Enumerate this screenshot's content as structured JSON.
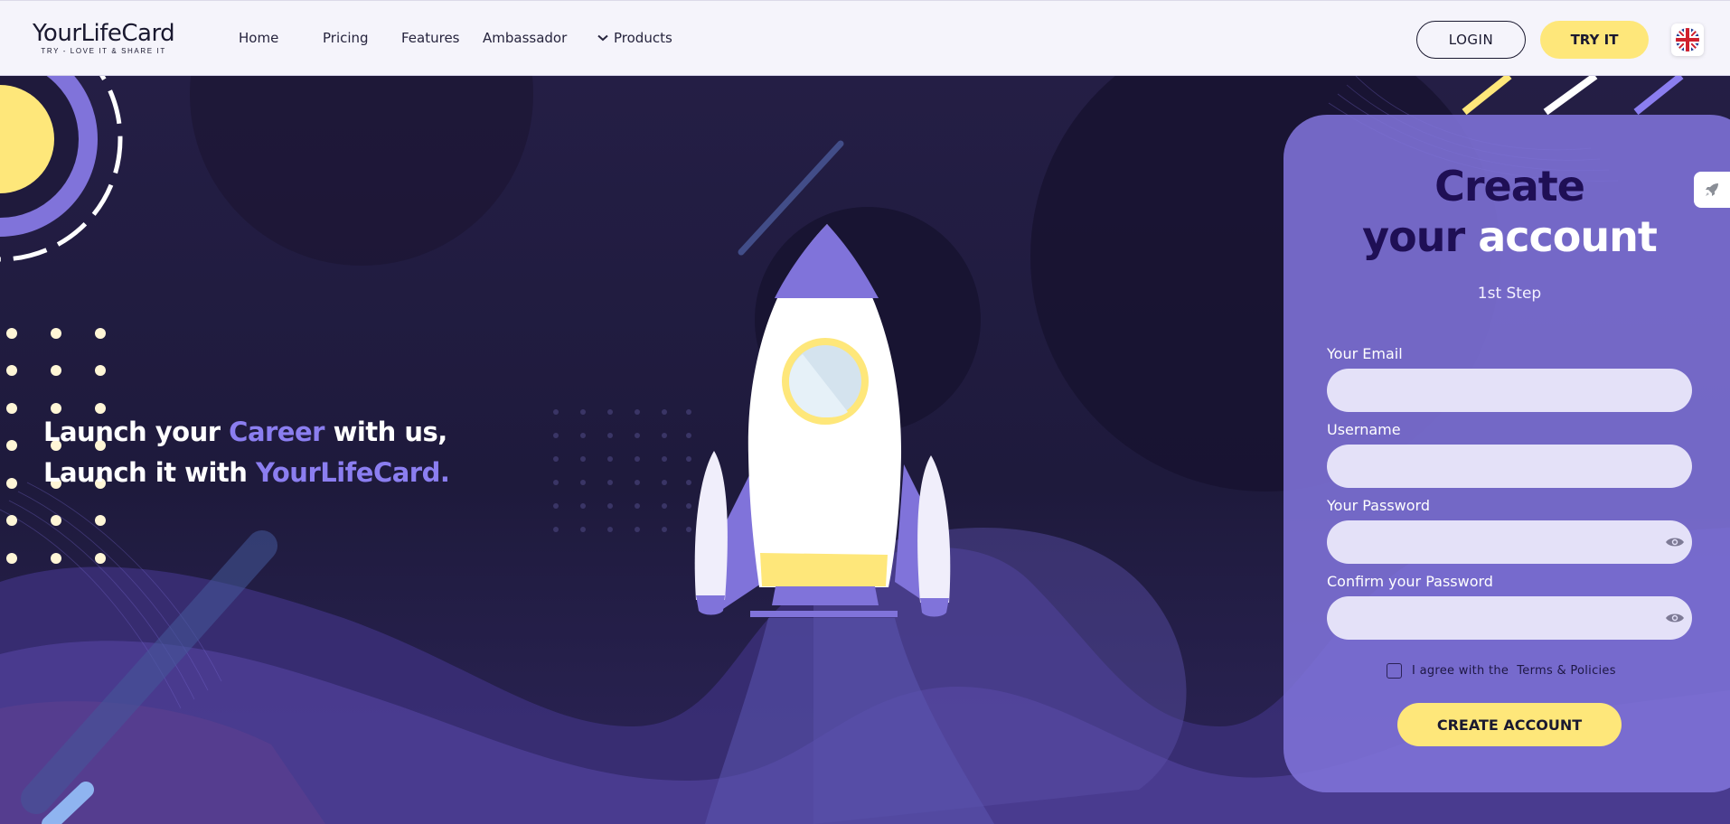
{
  "header": {
    "logo_title": "YourLifeCard",
    "logo_tagline": "TRY - LOVE IT & SHARE IT",
    "nav": {
      "home": "Home",
      "pricing": "Pricing",
      "features": "Features",
      "ambassador": "Ambassador",
      "products": "Products"
    },
    "login_label": "LOGIN",
    "try_label": "TRY IT",
    "language_icon": "uk-flag-icon"
  },
  "hero": {
    "line1_prefix": "Launch your",
    "line1_accent": "Career",
    "line1_suffix": "with us,",
    "line2_prefix": "Launch it with",
    "line2_accent": "YourLifeCard."
  },
  "form": {
    "title_line1": "Create",
    "title_line2_dark": "your",
    "title_line2_light": "account",
    "step": "1st Step",
    "email_label": "Your Email",
    "email_value": "",
    "username_label": "Username",
    "username_value": "",
    "password_label": "Your Password",
    "password_value": "",
    "confirm_label": "Confirm your Password",
    "confirm_value": "",
    "agree_text": "I agree with the",
    "terms_link": "Terms & Policies",
    "terms_checked": false,
    "submit_label": "CREATE ACCOUNT"
  },
  "colors": {
    "accent_yellow": "#fee77a",
    "accent_purple": "#8b7ef0",
    "card": "#8073da",
    "dark_navy": "#1f0f55"
  }
}
